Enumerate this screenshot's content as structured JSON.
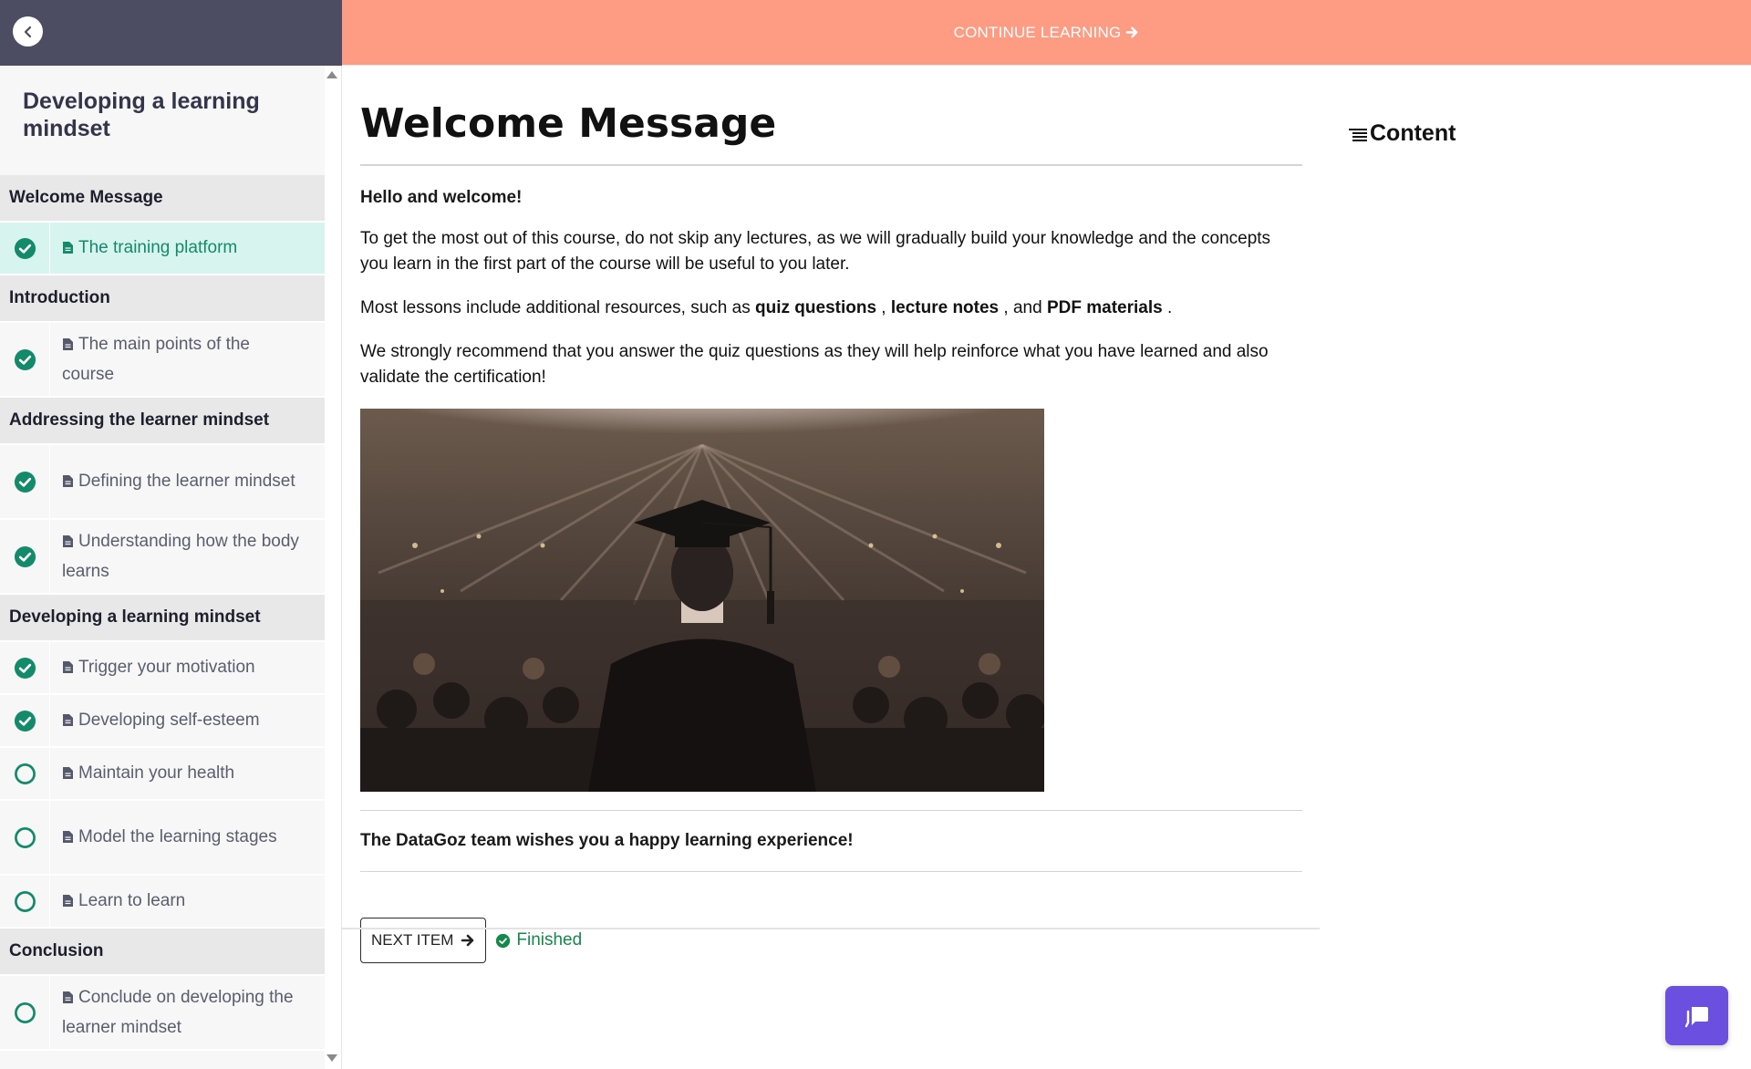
{
  "topbar": {
    "continue_label": "CONTINUE LEARNING"
  },
  "sidebar": {
    "course_title": "Developing a learning mindset",
    "sections": [
      {
        "title": "Welcome Message",
        "lessons": [
          {
            "label": "The training platform",
            "status": "completed",
            "active": true
          }
        ]
      },
      {
        "title": "Introduction",
        "lessons": [
          {
            "label": "The main points of the course",
            "status": "completed",
            "active": false
          }
        ]
      },
      {
        "title": "Addressing the learner mindset",
        "lessons": [
          {
            "label": "Defining the learner mindset",
            "status": "completed",
            "active": false
          },
          {
            "label": "Understanding how the body learns",
            "status": "completed",
            "active": false
          }
        ]
      },
      {
        "title": "Developing a learning mindset",
        "lessons": [
          {
            "label": "Trigger your motivation",
            "status": "completed",
            "active": false
          },
          {
            "label": "Developing self-esteem",
            "status": "completed",
            "active": false
          },
          {
            "label": "Maintain your health",
            "status": "incomplete",
            "active": false
          },
          {
            "label": "Model the learning stages",
            "status": "incomplete",
            "active": false
          },
          {
            "label": "Learn to learn",
            "status": "incomplete",
            "active": false
          }
        ]
      },
      {
        "title": "Conclusion",
        "lessons": [
          {
            "label": "Conclude on developing the learner mindset",
            "status": "incomplete",
            "active": false
          }
        ]
      }
    ]
  },
  "main": {
    "title": "Welcome Message",
    "greeting": "Hello and welcome!",
    "para1": "To get the most out of this course, do not skip any lectures, as we will gradually build your knowledge and the concepts you learn in the first part of the course will be useful to you later.",
    "para2": {
      "prefix": "Most lessons include additional resources, such as ",
      "item1": "quiz questions",
      "sep1": " , ",
      "item2": "lecture notes",
      "sep2": " , and ",
      "item3": "PDF materials",
      "suffix": " ."
    },
    "para3": "We strongly recommend that you answer the quiz questions as they will help reinforce what you have learned and also validate the certification!",
    "closing": "The DataGoz team wishes you a happy learning experience!",
    "next_label": "NEXT ITEM",
    "finished_label": "Finished"
  },
  "toc": {
    "label": "Content"
  },
  "colors": {
    "topbar_left": "#4c4d63",
    "topbar_right": "#fd9b83",
    "completed_green": "#138a6a",
    "active_row": "#d7f5ee",
    "chat_button": "#6b4fe0"
  }
}
